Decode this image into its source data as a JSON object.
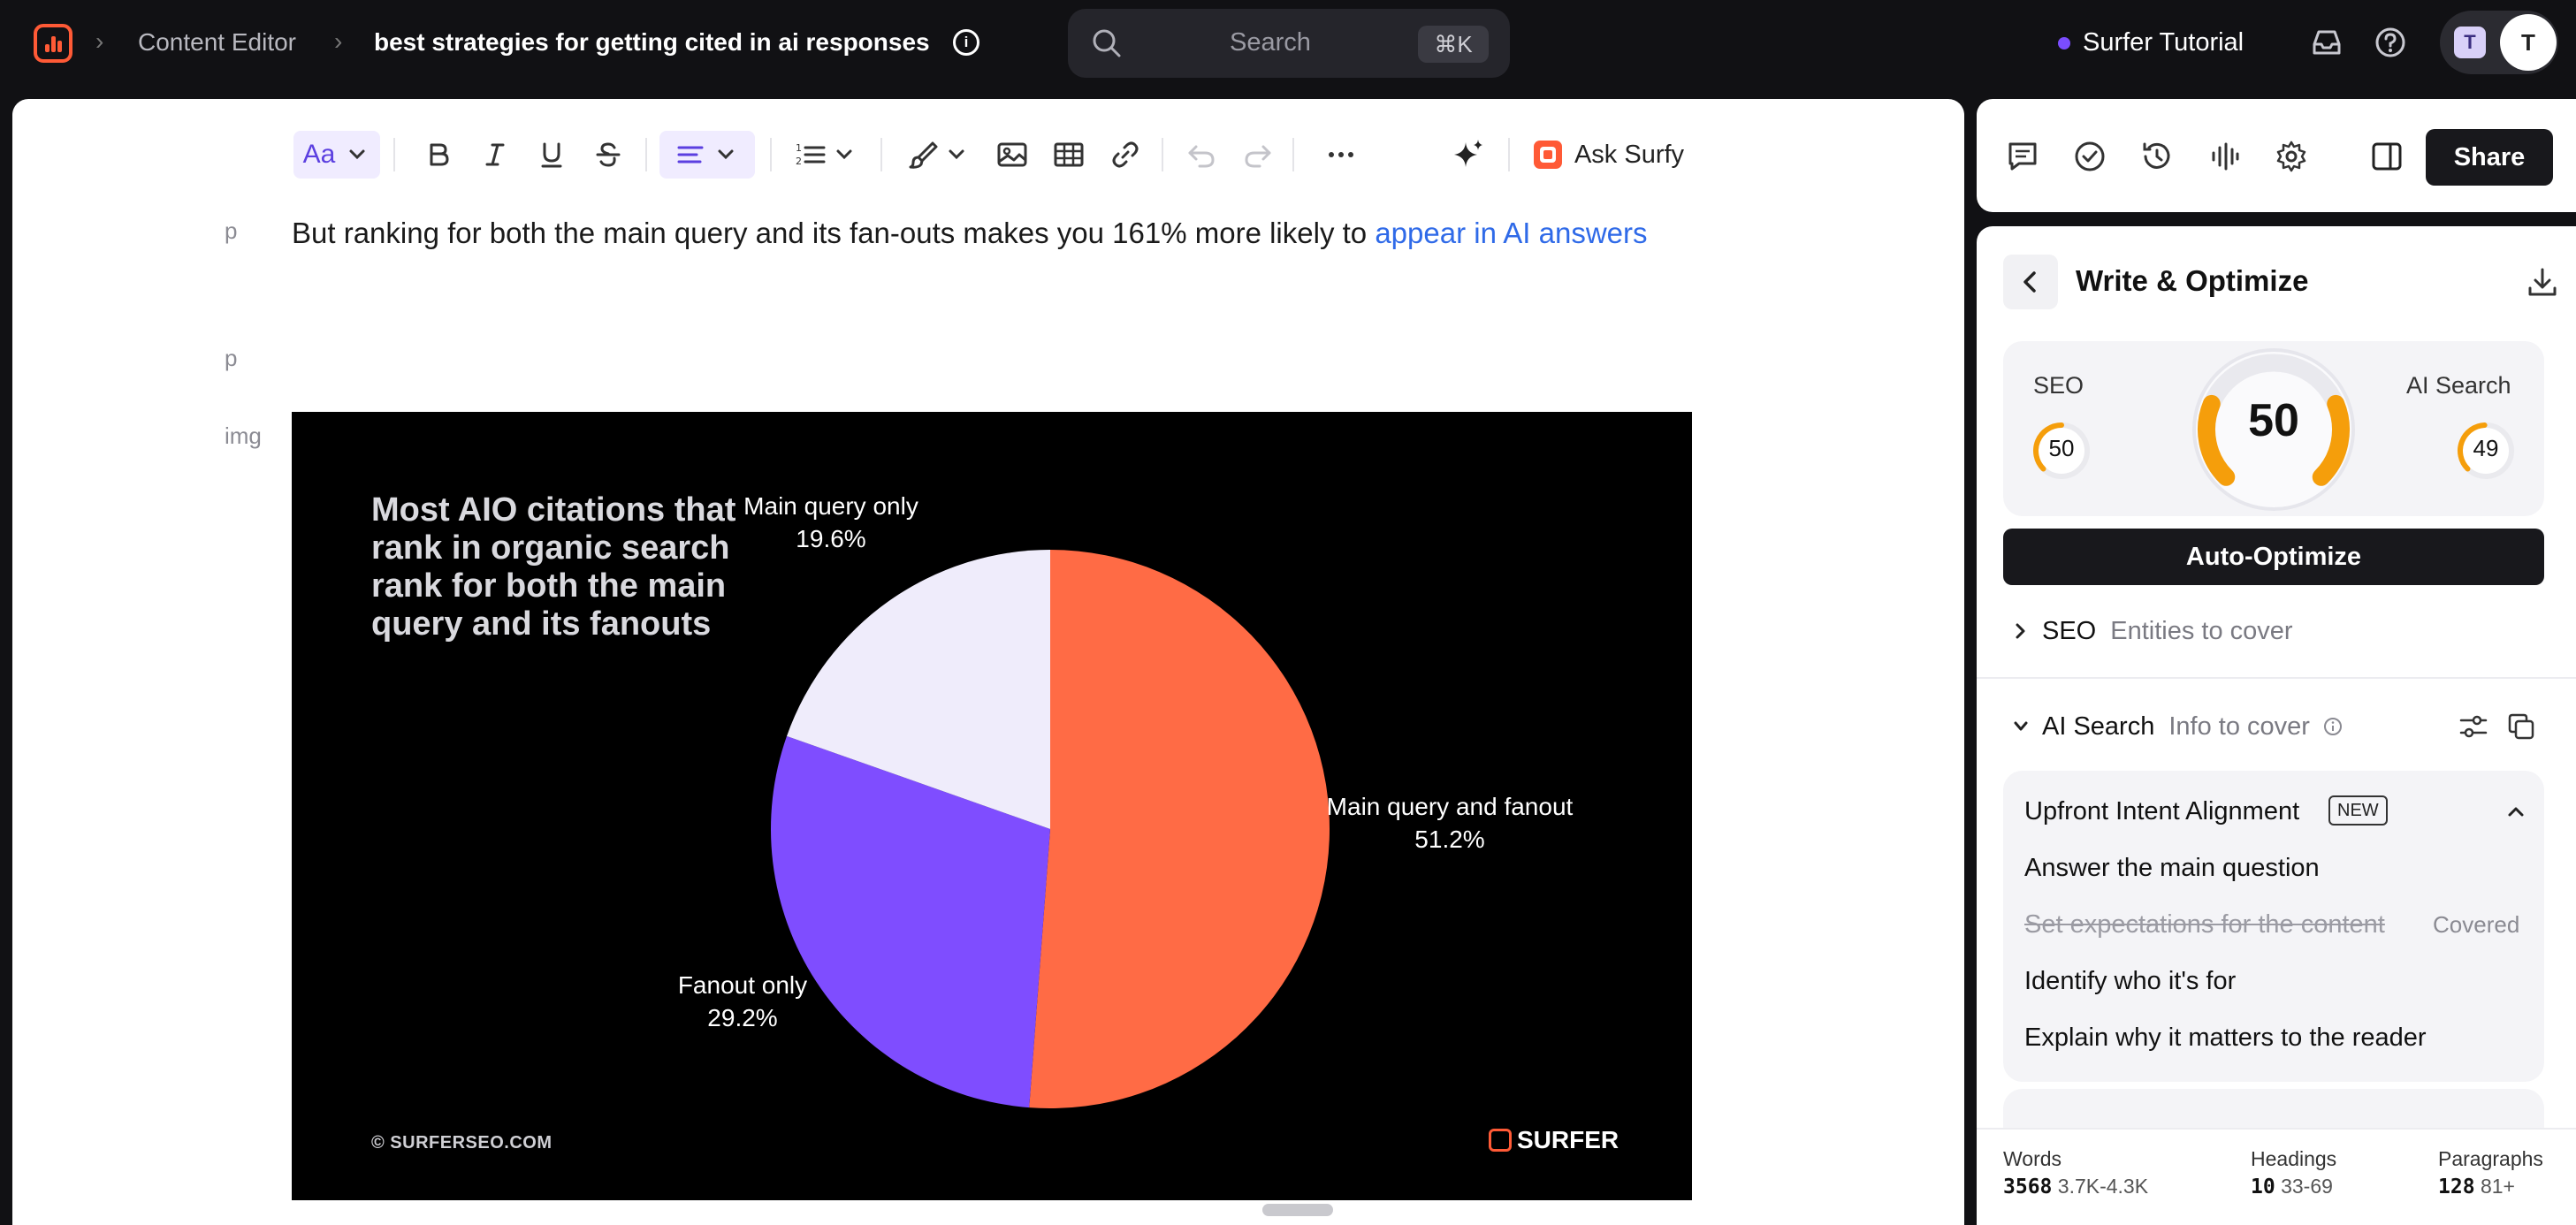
{
  "header": {
    "breadcrumb_app": "Content Editor",
    "document_title": "best strategies for getting cited in ai responses",
    "search_placeholder": "Search",
    "search_shortcut": "⌘K",
    "workspace": "Surfer Tutorial",
    "avatar_small": "T",
    "avatar_large": "T",
    "status_color": "#7b4dff"
  },
  "toolbar": {
    "font_label": "Aa",
    "ask_surfy": "Ask Surfy"
  },
  "editor": {
    "block_tags": [
      "p",
      "p",
      "img"
    ],
    "paragraph_text": "But ranking for both the main query and its fan-outs makes you 161% more likely to ",
    "paragraph_link": "appear in AI answers"
  },
  "figure": {
    "title": "Most AIO citations that rank in organic search rank for both the main query and its fanouts",
    "footer": "© SURFERSEO.COM",
    "brand": "SURFER",
    "chart_data": {
      "type": "pie",
      "title": "Most AIO citations that rank in organic search rank for both the main query and its fanouts",
      "categories": [
        "Main query and fanout",
        "Fanout only",
        "Main query only"
      ],
      "values": [
        51.2,
        29.2,
        19.6
      ],
      "value_labels": [
        "51.2%",
        "29.2%",
        "19.6%"
      ],
      "colors": [
        "#ff6b45",
        "#7f4dff",
        "#efecfb"
      ]
    }
  },
  "panel": {
    "share_label": "Share",
    "title": "Write & Optimize",
    "seo_label": "SEO",
    "seo_score": 50,
    "overall_score": 50,
    "ai_label": "AI Search",
    "ai_score": 49,
    "auto_optimize": "Auto-Optimize",
    "seo_section": {
      "name": "SEO",
      "sub": "Entities to cover"
    },
    "ai_section": {
      "name": "AI Search",
      "sub": "Info to cover"
    },
    "intent": {
      "title": "Upfront Intent Alignment",
      "badge": "NEW",
      "items": [
        {
          "text": "Answer the main question",
          "covered": false
        },
        {
          "text": "Set expectations for the content",
          "covered": true,
          "tag": "Covered"
        },
        {
          "text": "Identify who it's for",
          "covered": false
        },
        {
          "text": "Explain why it matters to the reader",
          "covered": false
        }
      ]
    },
    "accent_color": "#f59e0b"
  },
  "stats": {
    "words": {
      "label": "Words",
      "value": "3568",
      "range": "3.7K-4.3K"
    },
    "headings": {
      "label": "Headings",
      "value": "10",
      "range": "33-69"
    },
    "paragraphs": {
      "label": "Paragraphs",
      "value": "128",
      "range": "81+"
    }
  }
}
